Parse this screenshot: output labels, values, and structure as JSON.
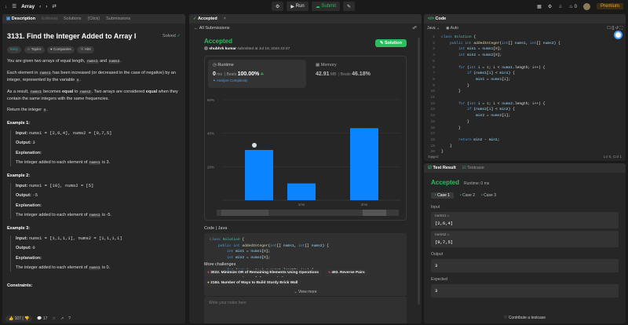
{
  "topbar": {
    "problem_list": "Array",
    "run": "Run",
    "submit": "Submit",
    "streak": "0",
    "premium": "Premium"
  },
  "left": {
    "tabs": [
      "Description",
      "Editorial",
      "Solutions",
      "(Click)",
      "Submissions"
    ],
    "title": "3131. Find the Integer Added to Array I",
    "solved": "Solved",
    "tags": [
      "Easy",
      "Topics",
      "Companies",
      "Hint"
    ],
    "p1a": "You are given two arrays of equal length,",
    "p1_code1": "nums1",
    "p1_and": "and",
    "p1_code2": "nums2",
    "p2a": "Each element in",
    "p2_code": "nums1",
    "p2b": "has been increased (or decreased in the case of negative) by an integer, represented by the variable",
    "p2_var": "x",
    "p3a": "As a result,",
    "p3_code1": "nums1",
    "p3b": "becomes",
    "p3_bold1": "equal",
    "p3c": "to",
    "p3_code2": "nums2",
    "p3d": ". Two arrays are considered",
    "p3_bold2": "equal",
    "p3e": "when they contain the same integers with the same frequencies.",
    "p4a": "Return the integer",
    "p4_var": "x",
    "examples": [
      {
        "title": "Example 1:",
        "input": "nums1 = [2,6,4], nums2 = [9,7,5]",
        "output": "3",
        "exp": "The integer added to each element of",
        "code": "nums1",
        "exp_end": "is 3."
      },
      {
        "title": "Example 2:",
        "input": "nums1 = [10], nums2 = [5]",
        "output": "-5",
        "exp": "The integer added to each element of",
        "code": "nums1",
        "exp_end": "is -5."
      },
      {
        "title": "Example 3:",
        "input": "nums1 = [1,1,1,1], nums2 = [1,1,1,1]",
        "output": "0",
        "exp": "The integer added to each element of",
        "code": "nums1",
        "exp_end": "is 0."
      }
    ],
    "input_label": "Input:",
    "output_label": "Output:",
    "explanation_label": "Explanation:",
    "constraints": "Constraints:",
    "likes": "107",
    "comments": "17"
  },
  "mid": {
    "tab": "Accepted",
    "back": "All Submissions",
    "status": "Accepted",
    "user": "shubhrk kumar",
    "submitted": "submitted at Jul 19, 2024 22:47",
    "solution_btn": "Solution",
    "runtime_label": "Runtime",
    "runtime_value": "0",
    "runtime_unit": "ms",
    "beats": "Beats",
    "runtime_pct": "100.00%",
    "analyze": "Analyze Complexity",
    "memory_label": "Memory",
    "memory_value": "42.91",
    "memory_unit": "MB",
    "memory_pct": "46.18%",
    "code_header": "Code",
    "lang": "Java",
    "view_more": "View more",
    "more_challenges": "More challenges",
    "challenges": [
      "3022. Minimize OR of Remaining Elements Using Operations",
      "493. Reverse Pairs",
      "2184. Number of Ways to Build Sturdy Brick Wall"
    ],
    "notes_placeholder": "Write your notes here"
  },
  "chart_data": {
    "type": "bar",
    "yticks": [
      "60%",
      "40%",
      "20%"
    ],
    "xticks": [
      "1ms",
      "2ms"
    ],
    "values": [
      30,
      10,
      43
    ],
    "ylim": [
      0,
      60
    ]
  },
  "editor": {
    "tab": "Code",
    "lang": "Java",
    "mode": "Auto",
    "saved": "Saved",
    "cursor": "Ln 5, Col 1",
    "line_count": 21
  },
  "test": {
    "tabs": [
      "Test Result",
      "Testcase"
    ],
    "status": "Accepted",
    "runtime": "Runtime: 0 ms",
    "cases": [
      "Case 1",
      "Case 2",
      "Case 3"
    ],
    "input_label": "Input",
    "var1": "nums1 =",
    "val1": "[2,6,4]",
    "var2": "nums2 =",
    "val2": "[9,7,5]",
    "output_label": "Output",
    "output": "3",
    "expected_label": "Expected",
    "expected": "3",
    "contribute": "Contribute a testcase"
  }
}
